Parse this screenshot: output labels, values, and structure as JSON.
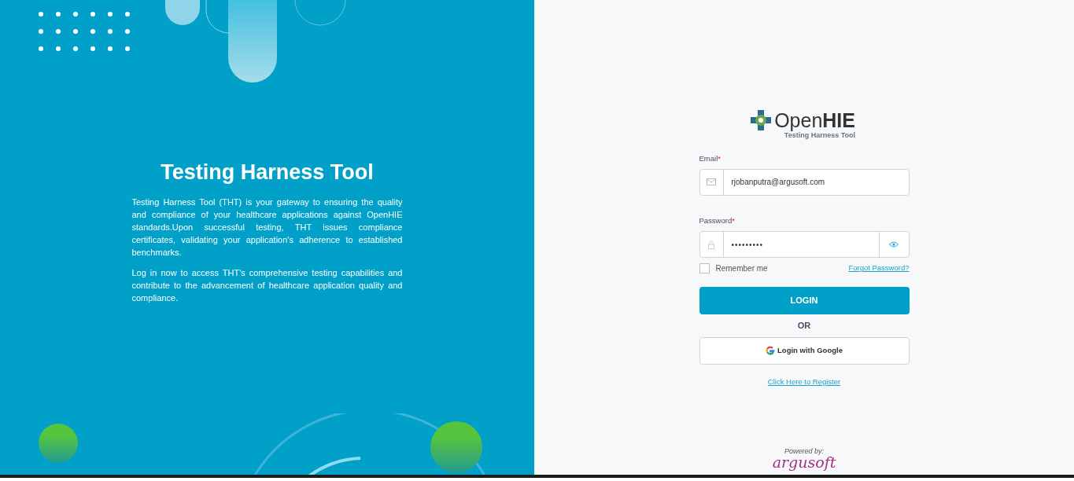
{
  "intro": {
    "title": "Testing Harness Tool",
    "paragraphs": [
      "Testing Harness Tool (THT) is your gateway to ensuring the quality and compliance of your healthcare applications against OpenHIE standards.Upon successful testing, THT issues compliance certificates, validating your application's adherence to established benchmarks.",
      "Log in now to access THT's comprehensive testing capabilities and contribute to the advancement of healthcare application quality and compliance."
    ]
  },
  "logo": {
    "word_light": "Open",
    "word_bold": "HIE",
    "subtitle": "Testing Harness Tool"
  },
  "form": {
    "email": {
      "label": "Email",
      "required_mark": "*",
      "value": "rjobanputra@argusoft.com"
    },
    "password": {
      "label": "Password",
      "required_mark": "*",
      "value": "•••••••••"
    },
    "remember": {
      "label": "Remember me",
      "checked": false
    },
    "forgot_link": "Forgot Password?",
    "login_button": "LOGIN",
    "divider": "OR",
    "google_button": "Login with Google",
    "register_link": "Click Here to Register"
  },
  "footer": {
    "powered_by": "Powered by:",
    "brand": "argusoft"
  }
}
